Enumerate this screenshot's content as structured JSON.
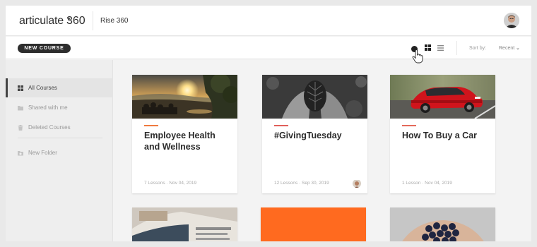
{
  "header": {
    "logo_word": "articulate",
    "logo_number": "360",
    "app_name": "Rise 360"
  },
  "toolbar": {
    "new_course_label": "NEW COURSE",
    "sort_label": "Sort by:",
    "sort_value": "Recent"
  },
  "sidebar": {
    "items": [
      {
        "label": "All Courses"
      },
      {
        "label": "Shared with me"
      },
      {
        "label": "Deleted Courses"
      },
      {
        "label": "New Folder"
      }
    ]
  },
  "courses": [
    {
      "title": "Employee Health and Wellness",
      "meta": "7 Lessons · Nov 04, 2019",
      "accent": "#f07a3e"
    },
    {
      "title": "#GivingTuesday",
      "meta": "12 Lessons · Sep 30, 2019",
      "accent": "#e0605a"
    },
    {
      "title": "How To Buy a Car",
      "meta": "1 Lesson · Nov 04, 2019",
      "accent": "#e46a5a"
    }
  ],
  "colors": {
    "orange_tile": "#ff6a1f",
    "dark_button": "#2d2d2d"
  }
}
